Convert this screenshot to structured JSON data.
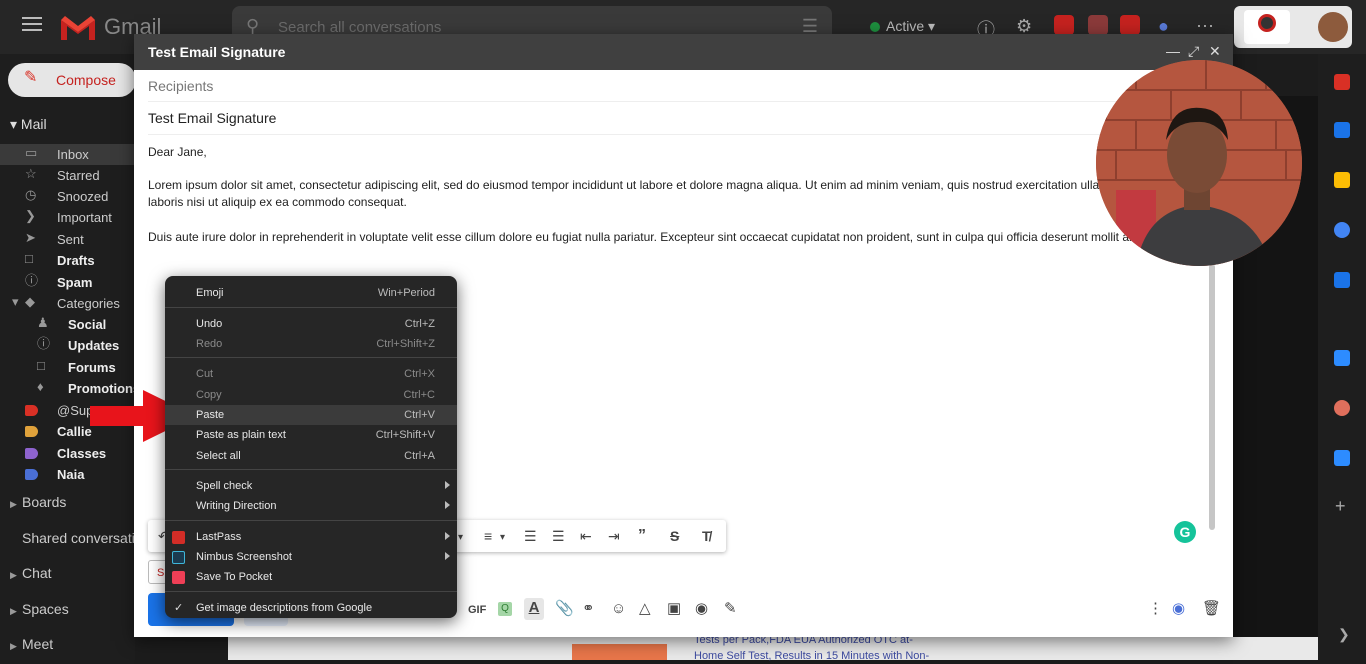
{
  "app": {
    "brand": "Gmail"
  },
  "search": {
    "placeholder": "Search all conversations"
  },
  "status": {
    "label": "Active"
  },
  "sidebar": {
    "compose_label": "Compose",
    "mail_heading": "Mail",
    "items": [
      {
        "label": "Inbox",
        "icon": "inbox-icon"
      },
      {
        "label": "Starred",
        "icon": "star-icon"
      },
      {
        "label": "Snoozed",
        "icon": "clock-icon"
      },
      {
        "label": "Important",
        "icon": "label-important-icon"
      },
      {
        "label": "Sent",
        "icon": "send-icon"
      },
      {
        "label": "Drafts",
        "icon": "draft-icon"
      },
      {
        "label": "Spam",
        "icon": "report-icon"
      },
      {
        "label": "Categories",
        "icon": "label-icon"
      },
      {
        "label": "Social",
        "icon": "people-icon"
      },
      {
        "label": "Updates",
        "icon": "info-icon"
      },
      {
        "label": "Forums",
        "icon": "forum-icon"
      },
      {
        "label": "Promotions",
        "icon": "tag-icon"
      },
      {
        "label": "@Sup",
        "icon": "label-icon"
      },
      {
        "label": "Callie",
        "icon": "label-icon"
      },
      {
        "label": "Classes",
        "icon": "label-icon"
      },
      {
        "label": "Naia",
        "icon": "label-icon"
      }
    ],
    "label_colors": {
      "sup": "#d93025",
      "callie": "#e0a23b",
      "classes": "#8e63ce",
      "naia": "#4a6fd6"
    },
    "bottom": [
      "Boards",
      "Shared conversati",
      "Chat",
      "Spaces",
      "Meet"
    ]
  },
  "compose": {
    "title": "Test Email Signature",
    "recipients_placeholder": "Recipients",
    "subject": "Test Email Signature",
    "greeting": "Dear Jane,",
    "paragraph1": "Lorem ipsum dolor sit amet, consectetur adipiscing elit, sed do eiusmod tempor incididunt ut labore et dolore magna aliqua. Ut enim ad minim veniam, quis nostrud exercitation ullamco laboris nisi ut aliquip ex ea commodo consequat.",
    "paragraph2": "Duis aute irure dolor in reprehenderit in voluptate velit esse cillum dolore eu fugiat nulla pariatur. Excepteur sint occaecat cupidatat non proident, sunt in culpa qui officia deserunt mollit anim id est laborum.",
    "from_stub": "S",
    "gif_label": "GIF",
    "grammarly_label": "G"
  },
  "context_menu": {
    "items": [
      {
        "label": "Emoji",
        "shortcut": "Win+Period",
        "disabled": false
      },
      {
        "label": "Undo",
        "shortcut": "Ctrl+Z",
        "disabled": false
      },
      {
        "label": "Redo",
        "shortcut": "Ctrl+Shift+Z",
        "disabled": true
      },
      {
        "label": "Cut",
        "shortcut": "Ctrl+X",
        "disabled": true
      },
      {
        "label": "Copy",
        "shortcut": "Ctrl+C",
        "disabled": true
      },
      {
        "label": "Paste",
        "shortcut": "Ctrl+V",
        "disabled": false,
        "highlighted": true
      },
      {
        "label": "Paste as plain text",
        "shortcut": "Ctrl+Shift+V",
        "disabled": false
      },
      {
        "label": "Select all",
        "shortcut": "Ctrl+A",
        "disabled": false
      },
      {
        "label": "Spell check",
        "shortcut": "",
        "submenu": true
      },
      {
        "label": "Writing Direction",
        "shortcut": "",
        "submenu": true
      },
      {
        "label": "LastPass",
        "shortcut": "",
        "submenu": true
      },
      {
        "label": "Nimbus Screenshot",
        "shortcut": "",
        "submenu": true
      },
      {
        "label": "Save To Pocket",
        "shortcut": ""
      },
      {
        "label": "Get image descriptions from Google",
        "shortcut": "",
        "checked": true
      }
    ]
  },
  "background": {
    "email_snippet_line1": "Tests per Pack,FDA EUA Authorized OTC at-",
    "email_snippet_line2": "Home Self Test, Results in 15 Minutes with Non-"
  },
  "colors": {
    "accent_red": "#d93025",
    "primary_blue": "#1a73e8",
    "header_dark": "#404040",
    "menu_bg": "#262626"
  }
}
